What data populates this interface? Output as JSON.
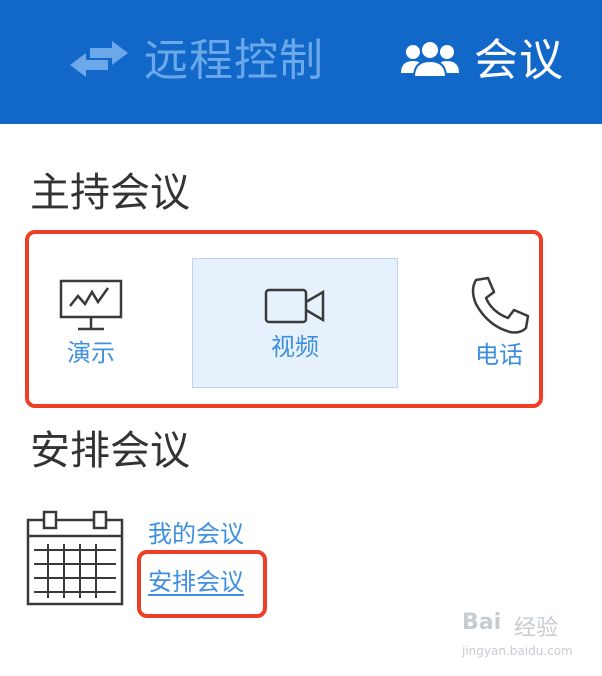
{
  "header": {
    "tabs": [
      {
        "label": "远程控制",
        "icon": "transfer-arrows-icon",
        "active": false
      },
      {
        "label": "会议",
        "icon": "group-users-icon",
        "active": true
      }
    ],
    "colors": {
      "bar": "#1168c9",
      "inactive": "#6aa8ea",
      "active": "#ffffff"
    }
  },
  "host": {
    "title": "主持会议",
    "options": [
      {
        "label": "演示",
        "icon": "monitor-chart-icon",
        "selected": false
      },
      {
        "label": "视频",
        "icon": "video-camera-icon",
        "selected": true
      },
      {
        "label": "电话",
        "icon": "phone-icon",
        "selected": false
      }
    ]
  },
  "schedule": {
    "title": "安排会议",
    "icon": "calendar-icon",
    "links": [
      {
        "label": "我的会议"
      },
      {
        "label": "安排会议"
      }
    ]
  },
  "watermark": {
    "brand": "Bai",
    "jingyan": "经验",
    "url": "jingyan.baidu.com"
  },
  "colors": {
    "highlight_border": "#ee3f24",
    "link": "#3f8fe0"
  }
}
